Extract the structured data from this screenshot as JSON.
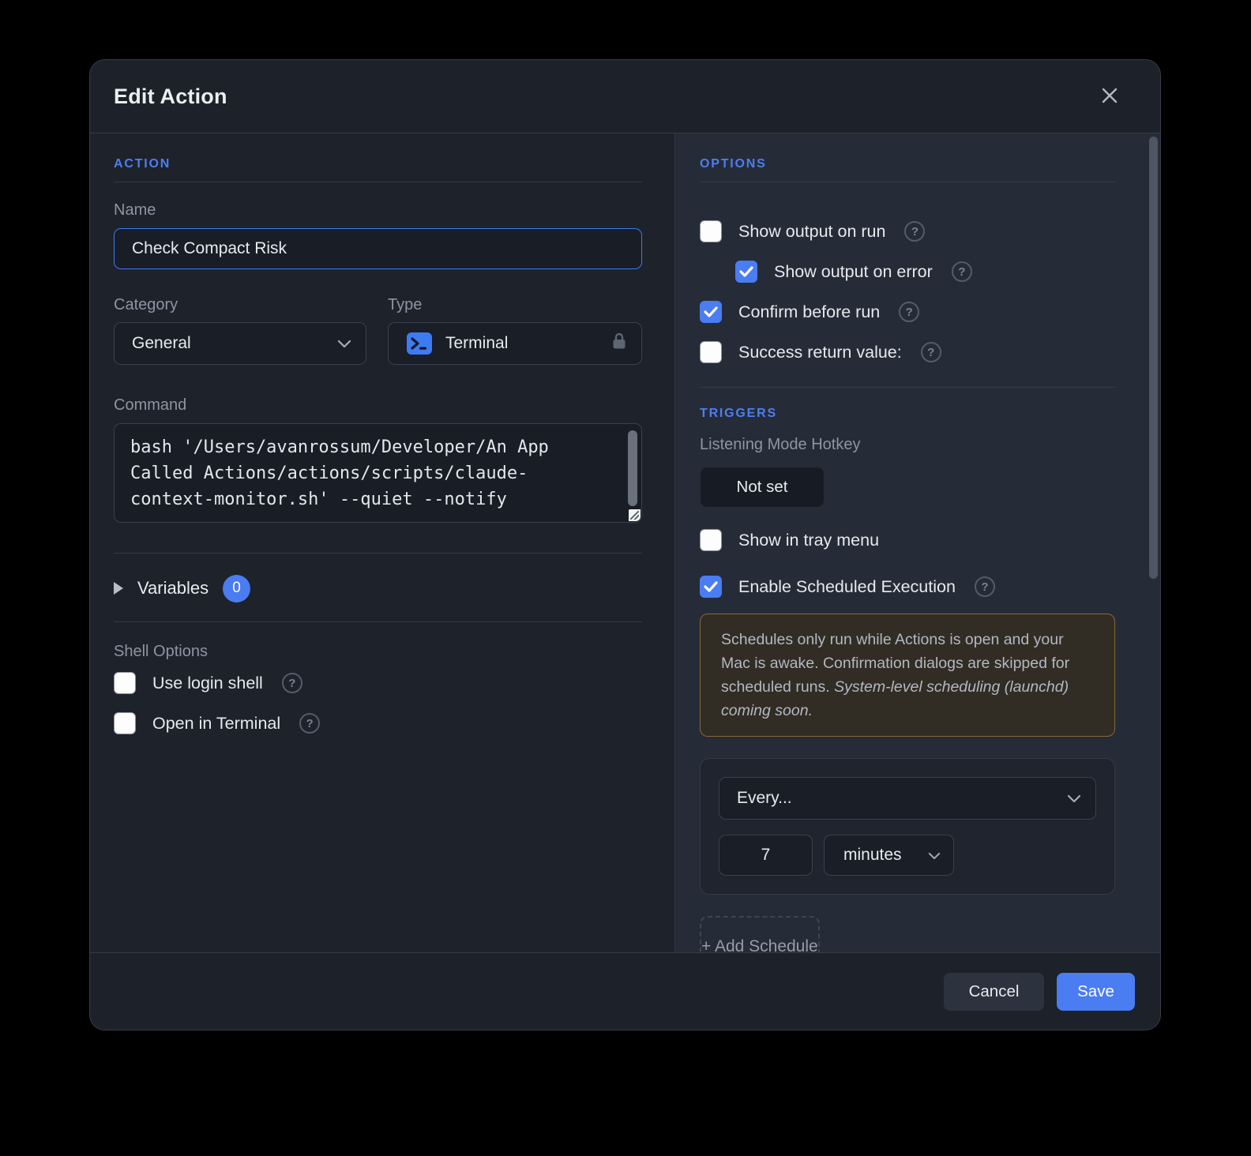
{
  "dialog": {
    "title": "Edit Action"
  },
  "action": {
    "header": "ACTION",
    "name": {
      "label": "Name",
      "value": "Check Compact Risk"
    },
    "category": {
      "label": "Category",
      "value": "General"
    },
    "type": {
      "label": "Type",
      "value": "Terminal"
    },
    "command": {
      "label": "Command",
      "value": "bash '/Users/avanrossum/Developer/An App Called Actions/actions/scripts/claude-context-monitor.sh' --quiet --notify"
    },
    "variables": {
      "label": "Variables",
      "count": "0"
    },
    "shell_options": {
      "label": "Shell Options",
      "use_login_shell": {
        "label": "Use login shell",
        "checked": false
      },
      "open_in_terminal": {
        "label": "Open in Terminal",
        "checked": false
      }
    }
  },
  "options": {
    "header": "OPTIONS",
    "show_output_on_run": {
      "label": "Show output on run",
      "checked": false
    },
    "show_output_on_error": {
      "label": "Show output on error",
      "checked": true
    },
    "confirm_before_run": {
      "label": "Confirm before run",
      "checked": true
    },
    "success_return_value": {
      "label": "Success return value:",
      "checked": false
    }
  },
  "triggers": {
    "header": "TRIGGERS",
    "hotkey": {
      "label": "Listening Mode Hotkey",
      "value": "Not set"
    },
    "show_in_tray": {
      "label": "Show in tray menu",
      "checked": false
    },
    "enable_scheduled": {
      "label": "Enable Scheduled Execution",
      "checked": true
    },
    "schedule_note": {
      "text": "Schedules only run while Actions is open and your Mac is awake. Confirmation dialogs are skipped for scheduled runs. ",
      "italic_text": "System-level scheduling (launchd) coming soon."
    },
    "schedule": {
      "frequency": "Every...",
      "interval": "7",
      "unit": "minutes"
    },
    "add_schedule_label": "+ Add Schedule"
  },
  "footer": {
    "cancel": "Cancel",
    "save": "Save"
  },
  "help_glyph": "?",
  "colors": {
    "accent_blue": "#4d7ef2",
    "checkbox_checked": "#4a7cf2",
    "save_button": "#4a7cf2",
    "warning_bg": "#322d24",
    "warning_border": "#86683a",
    "right_panel_bg": "#262c37",
    "left_panel_bg": "#1e222b"
  }
}
